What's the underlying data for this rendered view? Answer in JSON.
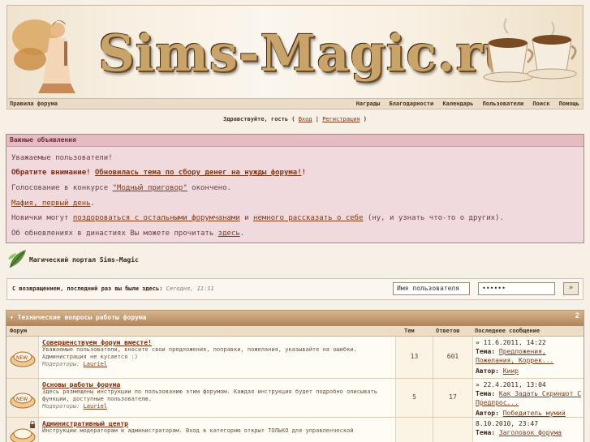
{
  "banner": {
    "logo_text": "Sims-Magic.ru"
  },
  "nav": {
    "left": "Правила форума",
    "right": [
      "Награды",
      "Благодарности",
      "Календарь",
      "Пользователи",
      "Поиск",
      "Помощь"
    ]
  },
  "welcome": {
    "prefix": "Здравствуйте, гость ( ",
    "login": "Вход",
    "sep": " | ",
    "register": "Регистрация",
    "suffix": " )"
  },
  "announcements": {
    "title": "Важные объявления",
    "line1": "Уважаемые пользователи!",
    "line2_bold": "Обратите внимание!",
    "line2_link": "Обновилась тема по сбору денег на нужды форума!",
    "line2_end": "!",
    "line3_pre": "Голосование в конкурсе ",
    "line3_link": "\"Модный приговор\"",
    "line3_post": " окончено.",
    "line4_link": "Мафия, первый день",
    "line4_post": ".",
    "line5_pre": "Новички могут ",
    "line5_link1": "поздороваться с остальными форумчанами",
    "line5_mid": " и ",
    "line5_link2": "немного рассказать о себе",
    "line5_post": " (ну, и узнать что-то о других).",
    "line6_pre": "Об обновлениях в династиях Вы можете прочитать ",
    "line6_link": "здесь",
    "line6_post": "."
  },
  "portal": {
    "title": "Магический портал Sims-Magic"
  },
  "login_bar": {
    "text": "С возвращением, последний раз вы были здесь:",
    "date": "Сегодня, 11:11",
    "username_value": "Имя пользователя",
    "password_value": "••••••",
    "go_label": "»"
  },
  "forum": {
    "category": "Технические вопросы работы форума",
    "toggle": "2",
    "columns": {
      "forum": "Форум",
      "topics": "Тем",
      "replies": "Ответов",
      "last": "Последнее сообщение"
    },
    "rows": [
      {
        "title": "Совершенствуем форум вместе!",
        "desc": "Уважаемые пользователи, вносите свои предложения, поправки, пожелания, указывайте на ошибки. Администрация не кусается :)",
        "mod_label": "Модераторы:",
        "mod": "Lauriel",
        "topics": "13",
        "replies": "601",
        "last_date": "» 11.6.2011, 14:22",
        "last_topic_label": "Тема:",
        "last_topic": "Предложения, Пожелания, Коррек...",
        "last_author_label": "Автор:",
        "last_author": "Киир"
      },
      {
        "title": "Основы работы форума",
        "desc": "Здесь размещены инструкции по пользованию этим форумом. Каждая инструкция будет подробно описывать функции, доступные пользователю.",
        "mod_label": "Модераторы:",
        "mod": "Lauriel",
        "topics": "5",
        "replies": "17",
        "last_date": "» 22.4.2011, 13:04",
        "last_topic_label": "Тема:",
        "last_topic": "Как Задать Скриншот С Предпрос...",
        "last_author_label": "Автор:",
        "last_author": "Победитель мумий"
      },
      {
        "title": "Административный центр",
        "desc": "Инструкции модераторам и администраторам. Вход в категорию открыт ТОЛЬКО для управленческой",
        "mod_label": "",
        "mod": "",
        "topics": "",
        "replies": "",
        "last_date": "8.10.2010, 23:47",
        "last_topic_label": "Тема:",
        "last_topic": "Заголовок форума",
        "last_author_label": "",
        "last_author": ""
      }
    ]
  },
  "colors": {
    "accent": "#7a3a1a",
    "category": "#b08455",
    "announcement_bg": "#f1dadd"
  }
}
